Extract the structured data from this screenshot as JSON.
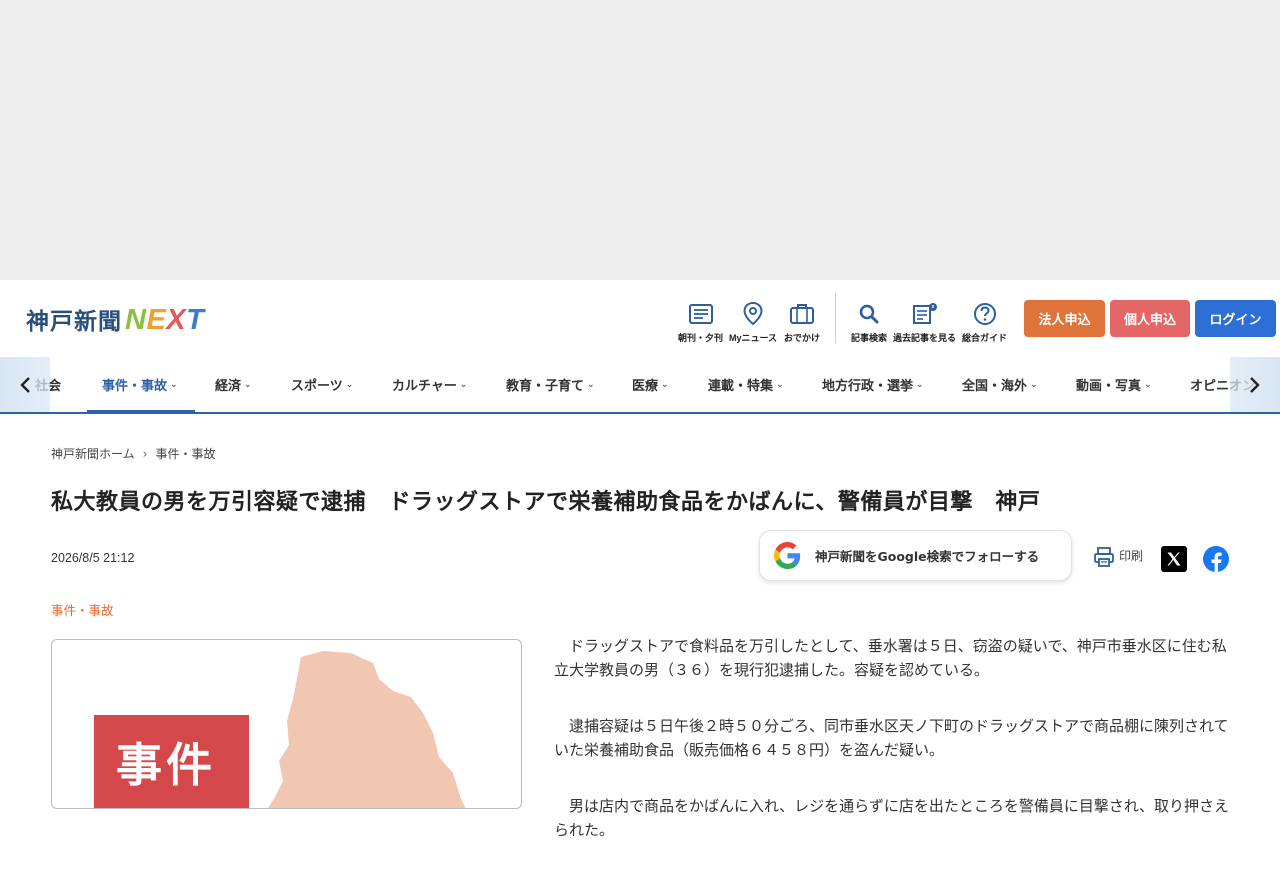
{
  "logo": {
    "jp": "神戸新聞",
    "next_letters": [
      {
        "ch": "N",
        "color": "#8cbf3f"
      },
      {
        "ch": "E",
        "color": "#f0a033"
      },
      {
        "ch": "X",
        "color": "#e45a5a"
      },
      {
        "ch": "T",
        "color": "#3a7ec7"
      }
    ]
  },
  "header_icons": [
    {
      "label": "朝刊・夕刊",
      "icon": "newspaper-icon"
    },
    {
      "label": "Myニュース",
      "icon": "map-pin-icon"
    },
    {
      "label": "おでかけ",
      "icon": "suitcase-icon"
    },
    {
      "label": "記事検索",
      "icon": "search-icon"
    },
    {
      "label": "過去記事を見る",
      "icon": "archive-icon"
    },
    {
      "label": "総合ガイド",
      "icon": "help-icon"
    }
  ],
  "buttons": {
    "corporate": {
      "label": "法人申込",
      "color": "#e0733a"
    },
    "personal": {
      "label": "個人申込",
      "color": "#e46666"
    },
    "login": {
      "label": "ログイン",
      "color": "#2e6fd6"
    }
  },
  "gnav": [
    {
      "label": "社会",
      "chev": false
    },
    {
      "label": "事件・事故",
      "chev": true,
      "active": true
    },
    {
      "label": "経済",
      "chev": true
    },
    {
      "label": "スポーツ",
      "chev": true
    },
    {
      "label": "カルチャー",
      "chev": true
    },
    {
      "label": "教育・子育て",
      "chev": true
    },
    {
      "label": "医療",
      "chev": true
    },
    {
      "label": "連載・特集",
      "chev": true
    },
    {
      "label": "地方行政・選挙",
      "chev": true
    },
    {
      "label": "全国・海外",
      "chev": true
    },
    {
      "label": "動画・写真",
      "chev": true
    },
    {
      "label": "オピニオン",
      "chev": false
    }
  ],
  "breadcrumb": {
    "home": "神戸新聞ホーム",
    "sep": "›",
    "current": "事件・事故"
  },
  "article": {
    "headline": "私大教員の男を万引容疑で逮捕　ドラッグストアで栄養補助食品をかばんに、警備員が目撃　神戸",
    "date": "2026/8/5 21:12",
    "category": "事件・事故",
    "photo_tag": "事件",
    "paragraphs": [
      "ドラッグストアで食料品を万引したとして、垂水署は５日、窃盗の疑いで、神戸市垂水区に住む私立大学教員の男（３６）を現行犯逮捕した。容疑を認めている。",
      "逮捕容疑は５日午後２時５０分ごろ、同市垂水区天ノ下町のドラッグストアで商品棚に陳列されていた栄養補助食品（販売価格６４５８円）を盗んだ疑い。",
      "男は店内で商品をかばんに入れ、レジを通らずに店を出たところを警備員に目撃され、取り押さえられた。"
    ]
  },
  "follow": {
    "label": "神戸新聞をGoogle検索でフォローする"
  },
  "print_label": "印刷"
}
